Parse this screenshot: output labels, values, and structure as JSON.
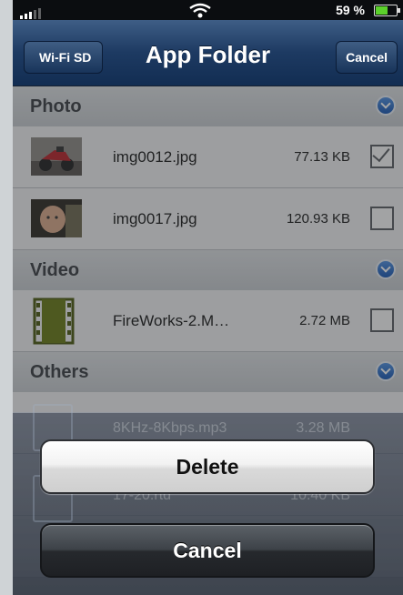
{
  "status_bar": {
    "battery_text": "59 %",
    "battery_level": 0.59,
    "icons": [
      "signal-icon",
      "wifi-icon",
      "battery-icon"
    ]
  },
  "navbar": {
    "back_label": "Wi-Fi SD",
    "title": "App Folder",
    "cancel_label": "Cancel"
  },
  "sections": {
    "photo": {
      "label": "Photo"
    },
    "video": {
      "label": "Video"
    },
    "others": {
      "label": "Others"
    }
  },
  "files": {
    "img1": {
      "name": "img0012.jpg",
      "size": "77.13 KB",
      "checked": true,
      "thumb": "motorcycle-photo"
    },
    "img2": {
      "name": "img0017.jpg",
      "size": "120.93 KB",
      "checked": false,
      "thumb": "baby-photo"
    },
    "video1": {
      "name": "FireWorks-2.M…",
      "size": "2.72 MB",
      "checked": false,
      "thumb": "film-icon"
    },
    "other1": {
      "name": "8KHz-8Kbps.mp3",
      "size": "3.28 MB"
    },
    "other2": {
      "name": "17-20.rtd",
      "size": "10.40 KB"
    }
  },
  "action_sheet": {
    "delete_label": "Delete",
    "cancel_label": "Cancel"
  },
  "colors": {
    "nav_top": "#3e5e86",
    "nav_bottom": "#122d52",
    "disclosure_blue": "#1a58b4",
    "battery_green": "#5bd12b"
  }
}
